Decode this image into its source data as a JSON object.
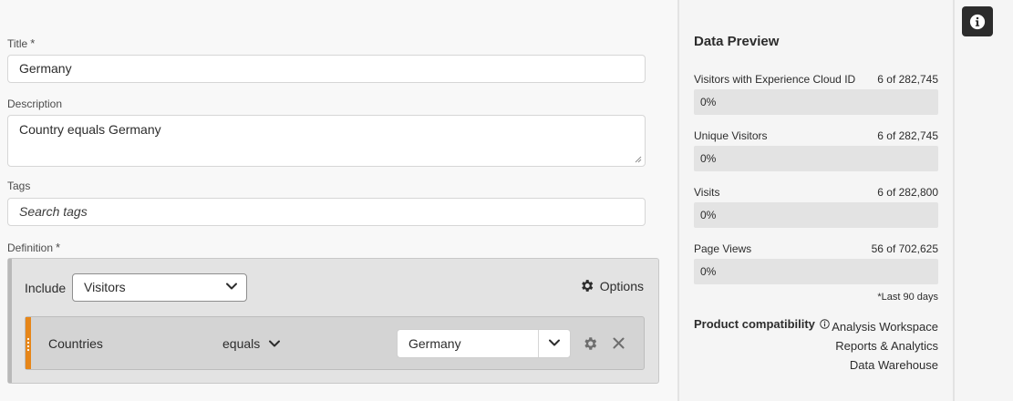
{
  "form": {
    "title_label": "Title",
    "title_required": "*",
    "title_value": "Germany",
    "description_label": "Description",
    "description_value": "Country equals Germany",
    "tags_label": "Tags",
    "tags_placeholder": "Search tags",
    "definition_label": "Definition",
    "definition_required": "*"
  },
  "definition": {
    "include_label": "Include",
    "container_value": "Visitors",
    "options_label": "Options",
    "rule": {
      "dimension": "Countries",
      "operator": "equals",
      "value": "Germany"
    }
  },
  "data_preview": {
    "title": "Data Preview",
    "metrics": [
      {
        "name": "Visitors with Experience Cloud ID",
        "count": "6 of 282,745",
        "percent_label": "0%",
        "fraction": 0.0
      },
      {
        "name": "Unique Visitors",
        "count": "6 of 282,745",
        "percent_label": "0%",
        "fraction": 0.0
      },
      {
        "name": "Visits",
        "count": "6 of 282,800",
        "percent_label": "0%",
        "fraction": 0.0
      },
      {
        "name": "Page Views",
        "count": "56 of 702,625",
        "percent_label": "0%",
        "fraction": 0.0
      }
    ],
    "footnote": "*Last 90 days",
    "compat_label": "Product compatibility",
    "compat_items": [
      "Analysis Workspace",
      "Reports & Analytics",
      "Data Warehouse"
    ]
  },
  "colors": {
    "accent_handle": "#e68619",
    "info_button_bg": "#2c2c2c"
  },
  "icons": [
    "asterisk-icon",
    "chevron-down-icon",
    "gear-icon",
    "close-icon",
    "drag-handle-icon",
    "info-circle-icon",
    "info-icon"
  ]
}
